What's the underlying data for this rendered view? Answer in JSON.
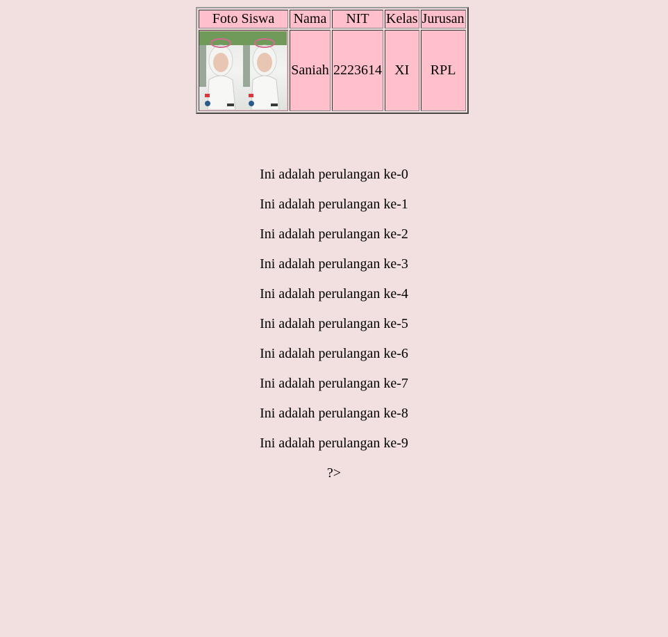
{
  "table": {
    "headers": [
      "Foto Siswa",
      "Nama",
      "NIT",
      "Kelas",
      "Jurusan"
    ],
    "row": {
      "nama": "Saniah",
      "nit": "2223614",
      "kelas": "XI",
      "jurusan": "RPL"
    }
  },
  "loop_lines": [
    "Ini adalah perulangan ke-0",
    "Ini adalah perulangan ke-1",
    "Ini adalah perulangan ke-2",
    "Ini adalah perulangan ke-3",
    "Ini adalah perulangan ke-4",
    "Ini adalah perulangan ke-5",
    "Ini adalah perulangan ke-6",
    "Ini adalah perulangan ke-7",
    "Ini adalah perulangan ke-8",
    "Ini adalah perulangan ke-9"
  ],
  "trailing_text": "?>",
  "colors": {
    "page_bg": "#f2dfdf",
    "cell_bg": "#ffc0cb"
  }
}
